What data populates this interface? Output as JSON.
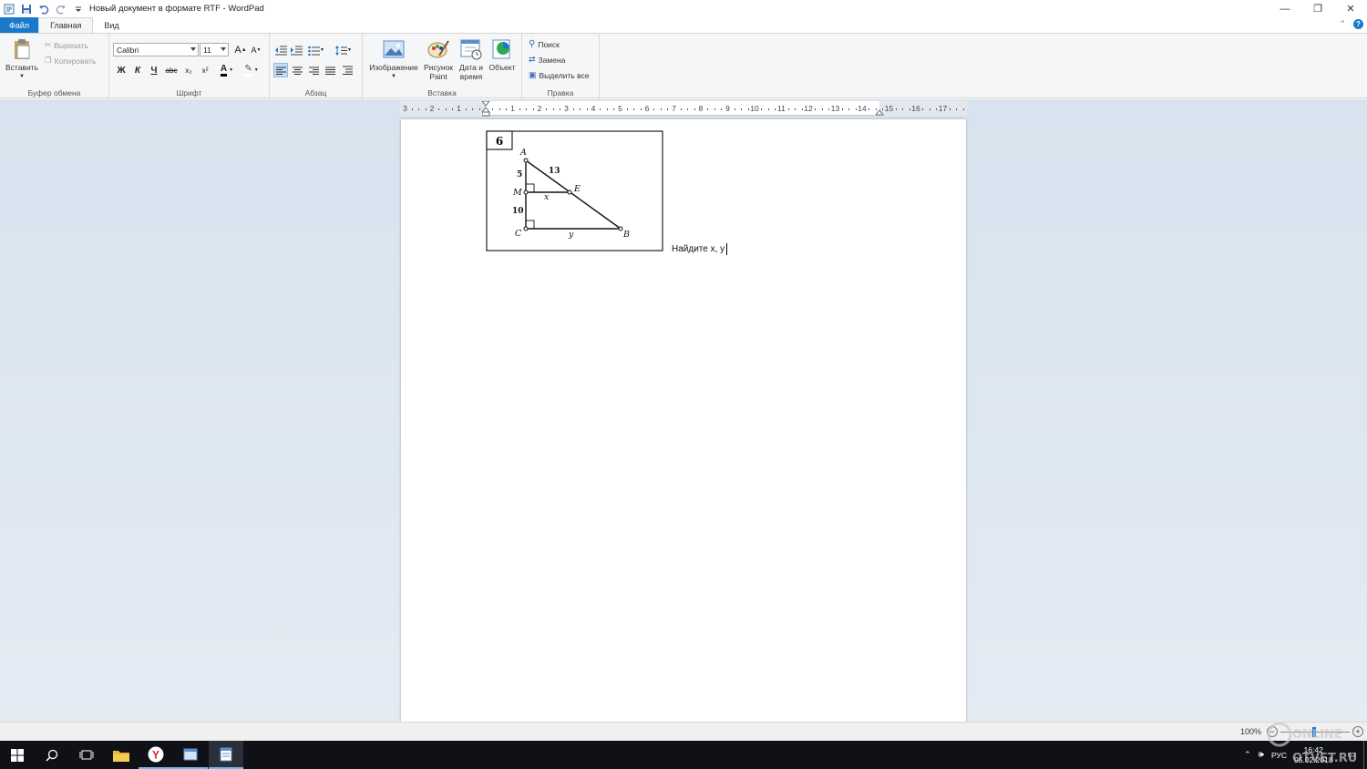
{
  "window": {
    "title": "Новый документ в формате RTF - WordPad",
    "controls": {
      "minimize": "—",
      "maximize": "❐",
      "close": "✕"
    }
  },
  "tabs": [
    {
      "label": "Файл"
    },
    {
      "label": "Главная"
    },
    {
      "label": "Вид"
    }
  ],
  "ribbon": {
    "clipboard": {
      "paste": "Вставить",
      "cut": "Вырезать",
      "copy": "Копировать",
      "group": "Буфер обмена"
    },
    "font": {
      "family": "Calibri",
      "size": "11",
      "group": "Шрифт",
      "bold": "Ж",
      "italic": "К",
      "underline": "Ч",
      "strike": "abc",
      "sub": "x₂",
      "sup": "x²",
      "color_letter": "A",
      "grow": "A",
      "shrink": "A"
    },
    "paragraph": {
      "group": "Абзац"
    },
    "insert": {
      "group": "Вставка",
      "picture": "Изображение",
      "paint": "Рисунок Paint",
      "paint_l1": "Рисунок",
      "paint_l2": "Paint",
      "datetime_l1": "Дата и",
      "datetime_l2": "время",
      "object": "Объект"
    },
    "edit": {
      "group": "Правка",
      "find": "Поиск",
      "replace": "Замена",
      "select_all": "Выделить все"
    }
  },
  "ruler": {
    "labels": [
      "3",
      "2",
      "1",
      "1",
      "2",
      "3",
      "4",
      "5",
      "6",
      "7",
      "8",
      "9",
      "10",
      "11",
      "12",
      "13",
      "14",
      "15",
      "16",
      "17"
    ]
  },
  "document": {
    "task_number": "6",
    "figure_labels": {
      "A": "A",
      "M": "M",
      "C": "C",
      "E": "E",
      "B": "B",
      "ae": "13",
      "am": "5",
      "mc": "10",
      "x": "x",
      "y": "y"
    },
    "text": "Найдите x, y"
  },
  "statusbar": {
    "zoom": "100%",
    "minus": "−",
    "plus": "+"
  },
  "watermark": "ONLINE OTVET.RU",
  "taskbar": {
    "lang": "РУС",
    "time": "16:42",
    "date": "05.02.2018"
  },
  "colors": {
    "accent": "#1979ca",
    "ribbon_bg": "#f5f6f7",
    "workspace": "#dce6f0",
    "taskbar": "#0f1117"
  }
}
